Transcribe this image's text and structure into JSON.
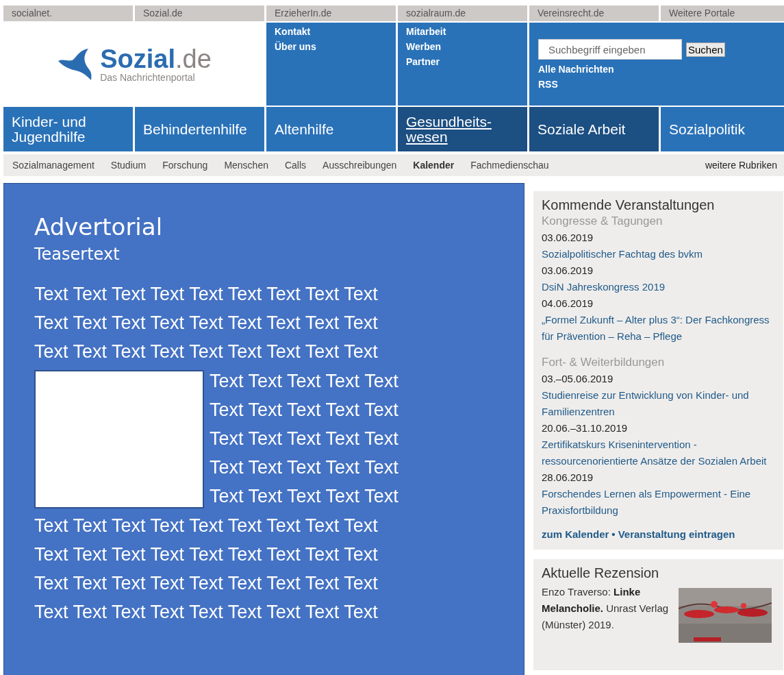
{
  "portals": [
    {
      "label": "socialnet."
    },
    {
      "label": "Sozial.de"
    },
    {
      "label": "ErzieherIn.de"
    },
    {
      "label": "sozialraum.de"
    },
    {
      "label": "Vereinsrecht.de"
    },
    {
      "label": "Weitere Portale"
    }
  ],
  "logo": {
    "name": "**Sozial**.de",
    "tagline": "Das Nachrichtenportal"
  },
  "header_links": [
    [
      "Kontakt",
      "Über uns"
    ],
    [
      "Mitarbeit",
      "Werben",
      "Partner"
    ]
  ],
  "search": {
    "placeholder": "Suchbegriff eingeben",
    "button": "Suchen",
    "links": [
      "Alle Nachrichten",
      "RSS"
    ]
  },
  "nav": [
    {
      "label": "Kinder- und Jugendhilfe",
      "highlighted": false,
      "underlined": false
    },
    {
      "label": "Behindertenhilfe",
      "highlighted": false,
      "underlined": false
    },
    {
      "label": "Altenhilfe",
      "highlighted": false,
      "underlined": false
    },
    {
      "label": "Gesundheits-wesen",
      "highlighted": true,
      "underlined": true
    },
    {
      "label": "Soziale Arbeit",
      "highlighted": true,
      "underlined": false
    },
    {
      "label": "Sozialpolitik",
      "highlighted": false,
      "underlined": false
    }
  ],
  "subnav": {
    "items": [
      {
        "label": "Sozialmanagement",
        "selected": false
      },
      {
        "label": "Studium",
        "selected": false
      },
      {
        "label": "Forschung",
        "selected": false
      },
      {
        "label": "Menschen",
        "selected": false
      },
      {
        "label": "Calls",
        "selected": false
      },
      {
        "label": "Ausschreibungen",
        "selected": false
      },
      {
        "label": "Kalender",
        "selected": true
      },
      {
        "label": "Fachmedienschau",
        "selected": false
      }
    ],
    "more": "weitere Rubriken"
  },
  "advertorial": {
    "title": "Advertorial",
    "teaser": "Teasertext",
    "lines_above": [
      "Text Text Text Text Text Text Text Text Text",
      "Text Text Text Text Text Text Text Text Text",
      "Text Text Text Text Text Text Text Text Text"
    ],
    "lines_beside": [
      "Text Text Text Text Text",
      "Text Text Text Text Text",
      "Text Text Text Text Text",
      "Text Text Text Text Text",
      "Text Text Text Text Text"
    ],
    "lines_below": [
      "Text Text Text Text Text Text Text Text Text",
      "Text Text Text Text Text Text Text Text Text",
      "Text Text Text Text Text Text Text Text Text",
      "Text Text Text Text Text Text Text Text Text"
    ]
  },
  "events": {
    "title": "Kommende Veranstaltungen",
    "groups": [
      {
        "title": "Kongresse & Tagungen",
        "items": [
          {
            "date": "03.06.2019",
            "title": "Sozialpolitischer Fachtag des bvkm"
          },
          {
            "date": "03.06.2019",
            "title": "DsiN Jahreskongress 2019"
          },
          {
            "date": "04.06.2019",
            "title": "„Formel Zukunft – Alter plus 3“: Der Fachkongress für Prävention – Reha – Pflege"
          }
        ]
      },
      {
        "title": "Fort- & Weiterbildungen",
        "items": [
          {
            "date": "03.–05.06.2019",
            "title": "Studienreise zur Entwicklung von Kinder- und Familienzentren"
          },
          {
            "date": "20.06.–31.10.2019",
            "title": "Zertifikatskurs Krisenintervention - ressourcenorientierte Ansätze der Sozialen Arbeit"
          },
          {
            "date": "28.06.2019",
            "title": "Forschendes Lernen als Empowerment - Eine Praxisfortbildung"
          }
        ]
      }
    ],
    "links": [
      "zum Kalender",
      "Veranstaltung eintragen"
    ],
    "separator": "•"
  },
  "review": {
    "title": "Aktuelle Rezension",
    "text": "Enzo Traverso: **Linke Melancholie.** Unrast Verlag (Münster) 2019."
  }
}
